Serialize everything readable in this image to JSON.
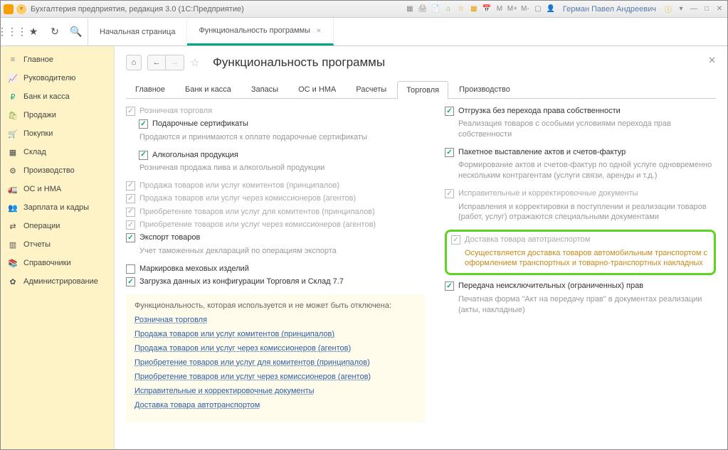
{
  "titlebar": {
    "title": "Бухгалтерия предприятия, редакция 3.0  (1С:Предприятие)",
    "user": "Герман Павел Андреевич"
  },
  "top_tabs": {
    "start": "Начальная страница",
    "func": "Функциональность программы"
  },
  "sidebar": [
    {
      "icon": "≡",
      "color": "#888",
      "label": "Главное"
    },
    {
      "icon": "📈",
      "color": "#c44",
      "label": "Руководителю"
    },
    {
      "icon": "₽",
      "color": "#2a8",
      "label": "Банк и касса"
    },
    {
      "icon": "🛍",
      "color": "#8a4",
      "label": "Продажи"
    },
    {
      "icon": "🛒",
      "color": "#444",
      "label": "Покупки"
    },
    {
      "icon": "▦",
      "color": "#444",
      "label": "Склад"
    },
    {
      "icon": "⚙",
      "color": "#555",
      "label": "Производство"
    },
    {
      "icon": "🚛",
      "color": "#555",
      "label": "ОС и НМА"
    },
    {
      "icon": "👥",
      "color": "#555",
      "label": "Зарплата и кадры"
    },
    {
      "icon": "⇄",
      "color": "#555",
      "label": "Операции"
    },
    {
      "icon": "▥",
      "color": "#555",
      "label": "Отчеты"
    },
    {
      "icon": "📚",
      "color": "#555",
      "label": "Справочники"
    },
    {
      "icon": "✿",
      "color": "#555",
      "label": "Администрирование"
    }
  ],
  "page_title": "Функциональность программы",
  "tabs": [
    "Главное",
    "Банк и касса",
    "Запасы",
    "ОС и НМА",
    "Расчеты",
    "Торговля",
    "Производство"
  ],
  "active_tab": "Торговля",
  "left_col": [
    {
      "type": "chk",
      "on": true,
      "disabled": true,
      "label": "Розничная торговля"
    },
    {
      "type": "chk",
      "on": true,
      "indent": true,
      "label": "Подарочные сертификаты"
    },
    {
      "type": "desc",
      "text": "Продаются и принимаются к оплате подарочные сертификаты"
    },
    {
      "type": "chk",
      "on": true,
      "indent": true,
      "label": "Алкогольная продукция"
    },
    {
      "type": "desc",
      "text": "Розничная продажа пива и алкогольной продукции"
    },
    {
      "type": "chk",
      "on": true,
      "disabled": true,
      "label": "Продажа товаров или услуг комитентов (принципалов)"
    },
    {
      "type": "chk",
      "on": true,
      "disabled": true,
      "label": "Продажа товаров или услуг через комиссионеров (агентов)"
    },
    {
      "type": "chk",
      "on": true,
      "disabled": true,
      "label": "Приобретение товаров или услуг для комитентов (принципалов)"
    },
    {
      "type": "chk",
      "on": true,
      "disabled": true,
      "label": "Приобретение товаров или услуг через комиссионеров (агентов)"
    },
    {
      "type": "chk",
      "on": true,
      "label": "Экспорт товаров"
    },
    {
      "type": "desc",
      "text": "Учет таможенных деклараций по операциям экспорта"
    },
    {
      "type": "chk",
      "on": false,
      "label": "Маркировка меховых изделий"
    },
    {
      "type": "chk",
      "on": true,
      "label": "Загрузка данных из конфигурации Торговля и Склад 7.7"
    }
  ],
  "right_col": [
    {
      "type": "chk",
      "on": true,
      "label": "Отгрузка без перехода права собственности"
    },
    {
      "type": "desc",
      "text": "Реализация товаров с особыми условиями перехода прав собственности"
    },
    {
      "type": "chk",
      "on": true,
      "label": "Пакетное выставление актов и счетов-фактур"
    },
    {
      "type": "desc",
      "text": "Формирование актов и счетов-фактур по одной услуге одновременно нескольким контрагентам (услуги связи, аренды и т.д.)"
    },
    {
      "type": "chk",
      "on": true,
      "disabled": true,
      "label": "Исправительные и корректировочные документы"
    },
    {
      "type": "desc",
      "text": "Исправления и корректировки в поступлении и реализации товаров (работ, услуг) отражаются специальными документами"
    },
    {
      "type": "hl_start"
    },
    {
      "type": "chk",
      "on": true,
      "disabled": true,
      "label": "Доставка товара автотранспортом"
    },
    {
      "type": "desc",
      "hl": true,
      "text": "Осуществляется доставка товаров автомобильным транспортом с оформлением транспортных и товарно-транспортных накладных"
    },
    {
      "type": "hl_end"
    },
    {
      "type": "chk",
      "on": true,
      "label": "Передача неисключительных (ограниченных) прав"
    },
    {
      "type": "desc",
      "text": "Печатная форма \"Акт на передачу прав\" в документах реализации (акты, накладные)"
    }
  ],
  "yellow_box": {
    "title": "Функциональность, которая используется и не может быть отключена:",
    "links": [
      "Розничная торговля",
      "Продажа товаров или услуг комитентов (принципалов)",
      "Продажа товаров или услуг через комиссионеров (агентов)",
      "Приобретение товаров или услуг для комитентов (принципалов)",
      "Приобретение товаров или услуг через комиссионеров (агентов)",
      "Исправительные и корректировочные документы",
      "Доставка товара автотранспортом"
    ]
  }
}
